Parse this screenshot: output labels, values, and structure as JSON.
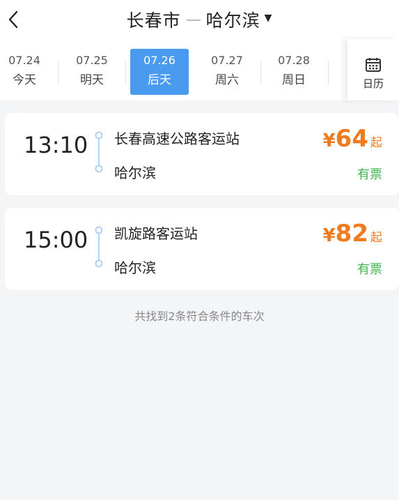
{
  "header": {
    "origin": "长春市",
    "destination": "哈尔滨"
  },
  "dates": [
    {
      "date": "07.24",
      "weekday": "今天",
      "active": false
    },
    {
      "date": "07.25",
      "weekday": "明天",
      "active": false
    },
    {
      "date": "07.26",
      "weekday": "后天",
      "active": true
    },
    {
      "date": "07.27",
      "weekday": "周六",
      "active": false
    },
    {
      "date": "07.28",
      "weekday": "周日",
      "active": false
    }
  ],
  "calendar": {
    "label": "日历"
  },
  "trips": [
    {
      "time": "13:10",
      "from": "长春高速公路客运站",
      "to": "哈尔滨",
      "currency": "¥",
      "price": "64",
      "price_suffix": "起",
      "availability": "有票"
    },
    {
      "time": "15:00",
      "from": "凯旋路客运站",
      "to": "哈尔滨",
      "currency": "¥",
      "price": "82",
      "price_suffix": "起",
      "availability": "有票"
    }
  ],
  "summary": "共找到2条符合条件的车次",
  "colors": {
    "accent": "#4a9bf0",
    "price": "#f07a1e",
    "available": "#3fb34f"
  }
}
